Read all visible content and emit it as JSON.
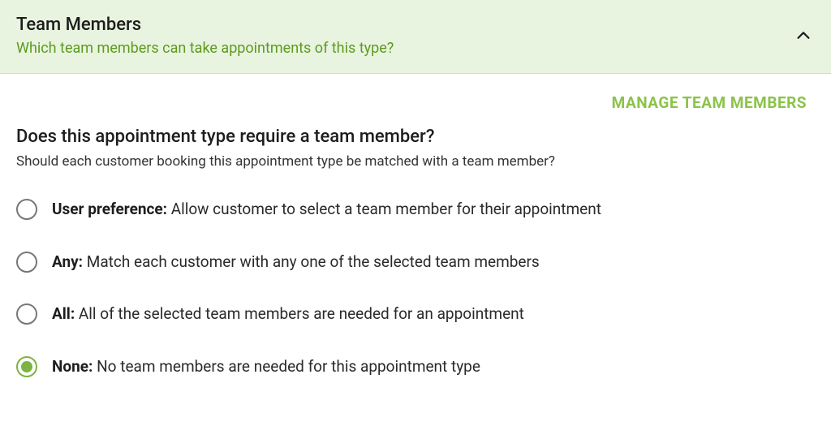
{
  "header": {
    "title": "Team Members",
    "subtitle": "Which team members can take appointments of this type?"
  },
  "body": {
    "manage_link": "MANAGE TEAM MEMBERS",
    "question_title": "Does this appointment type require a team member?",
    "question_sub": "Should each customer booking this appointment type be matched with a team member?"
  },
  "options": [
    {
      "key": "user_preference",
      "bold": "User preference:",
      "text": " Allow customer to select a team member for their appointment",
      "selected": false
    },
    {
      "key": "any",
      "bold": "Any:",
      "text": " Match each customer with any one of the selected team members",
      "selected": false
    },
    {
      "key": "all",
      "bold": "All:",
      "text": " All of the selected team members are needed for an appointment",
      "selected": false
    },
    {
      "key": "none",
      "bold": "None:",
      "text": " No team members are needed for this appointment type",
      "selected": true
    }
  ]
}
